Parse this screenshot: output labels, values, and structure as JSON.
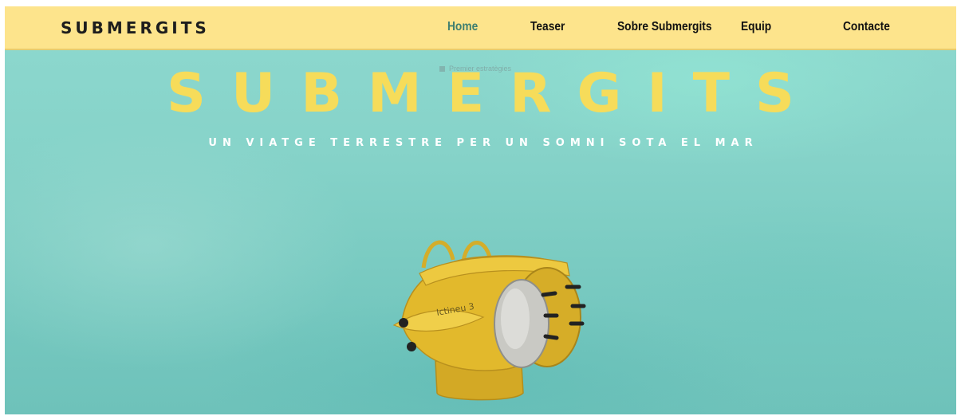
{
  "nav": {
    "brand": "SUBMERGITS",
    "links": [
      {
        "label": "Home",
        "active": true
      },
      {
        "label": "Teaser",
        "active": false
      },
      {
        "label": "Sobre Submergits",
        "active": false
      },
      {
        "label": "Equip",
        "active": false
      },
      {
        "label": "Contacte",
        "active": false
      }
    ]
  },
  "hero": {
    "title": "SUBMERGITS",
    "subtitle": "UN VIATGE TERRESTRE PER UN SOMNI SOTA EL MAR",
    "widget_label": "Premier estratègies",
    "submarine_label": "Ictineu 3"
  },
  "colors": {
    "nav_bg": "#fde48c",
    "active_link": "#3f7f70",
    "title_yellow": "#f6dc5a",
    "submarine_yellow": "#e2b92c"
  },
  "icons": [
    "submarine-illustration"
  ]
}
